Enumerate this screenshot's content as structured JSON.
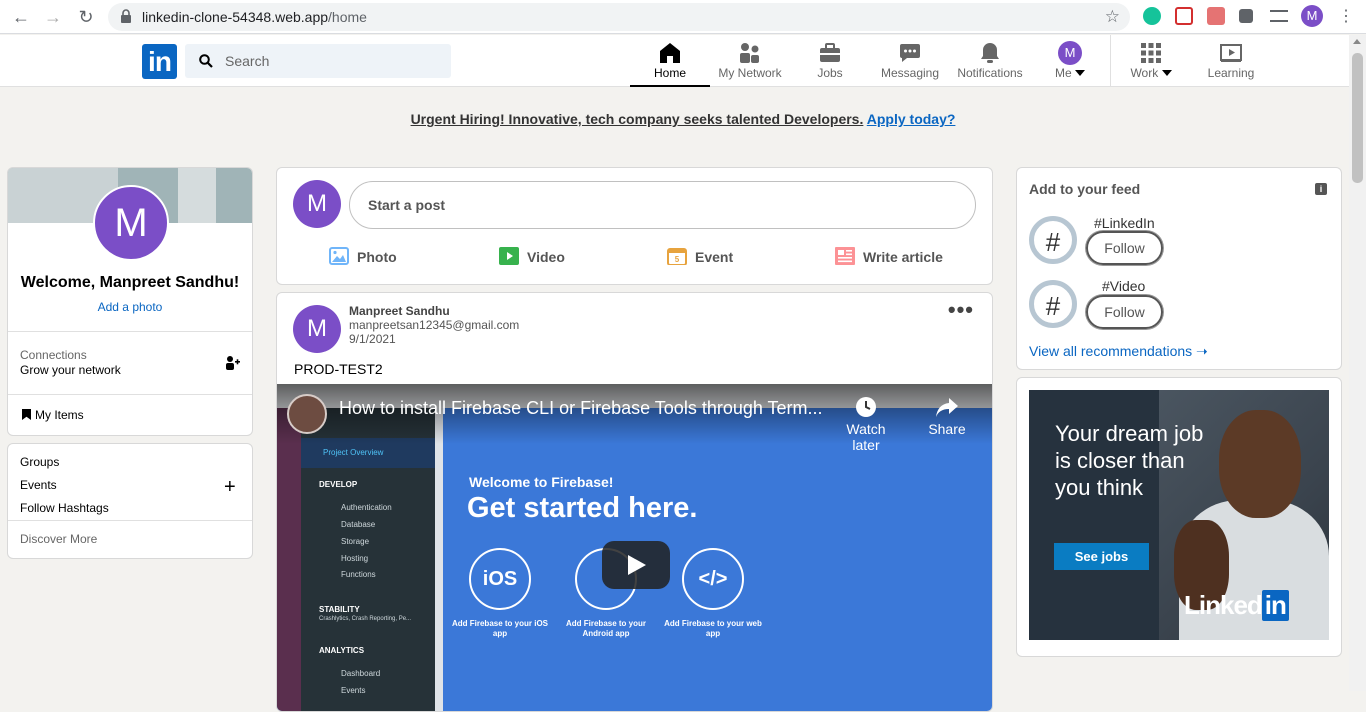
{
  "browser": {
    "url_host": "linkedin-clone-54348.web.app",
    "url_path": "/home",
    "profile_initial": "M"
  },
  "header": {
    "logo_text": "in",
    "search_placeholder": "Search",
    "nav": [
      {
        "label": "Home",
        "icon": "home-icon",
        "active": true
      },
      {
        "label": "My Network",
        "icon": "network-icon"
      },
      {
        "label": "Jobs",
        "icon": "briefcase-icon"
      },
      {
        "label": "Messaging",
        "icon": "messaging-icon"
      },
      {
        "label": "Notifications",
        "icon": "bell-icon"
      },
      {
        "label": "Me",
        "icon": "avatar",
        "initial": "M"
      },
      {
        "label": "Work",
        "icon": "grid-icon"
      },
      {
        "label": "Learning",
        "icon": "learning-icon"
      }
    ]
  },
  "banner": {
    "text": "Urgent Hiring! Innovative, tech company seeks talented Developers.",
    "link": "Apply today?"
  },
  "sidebar": {
    "avatar_initial": "M",
    "welcome": "Welcome, Manpreet Sandhu!",
    "add_photo": "Add a photo",
    "connections_label": "Connections",
    "connections_sub": "Grow your network",
    "my_items": "My Items",
    "groups": "Groups",
    "events": "Events",
    "hashtags": "Follow Hashtags",
    "discover": "Discover More"
  },
  "composer": {
    "avatar_initial": "M",
    "placeholder": "Start a post",
    "actions": [
      "Photo",
      "Video",
      "Event",
      "Write article"
    ]
  },
  "post": {
    "avatar_initial": "M",
    "author": "Manpreet Sandhu",
    "email": "manpreetsan12345@gmail.com",
    "date": "9/1/2021",
    "text": "PROD-TEST2",
    "more": "•••",
    "video": {
      "title": "How to install Firebase CLI or Firebase Tools through Term...",
      "watch_later": "Watch later",
      "share": "Share",
      "welcome": "Welcome to Firebase!",
      "headline": "Get started here.",
      "nav_header": "Project Overview",
      "nav_develop": "DEVELOP",
      "nav_items": [
        "Authentication",
        "Database",
        "Storage",
        "Hosting",
        "Functions"
      ],
      "nav_stability": "STABILITY",
      "nav_stability_sub": "Crashlytics, Crash Reporting, Pe...",
      "nav_analytics": "ANALYTICS",
      "nav_analytics_items": [
        "Dashboard",
        "Events"
      ],
      "platforms": [
        {
          "icon": "iOS",
          "caption": "Add Firebase to your iOS app"
        },
        {
          "icon": "",
          "caption": "Add Firebase to your Android app"
        },
        {
          "icon": "</>",
          "caption": "Add Firebase to your web app"
        }
      ]
    }
  },
  "feed": {
    "title": "Add to your feed",
    "info": "i",
    "hash": "#",
    "items": [
      {
        "tag": "#LinkedIn",
        "button": "Follow"
      },
      {
        "tag": "#Video",
        "button": "Follow"
      }
    ],
    "view_all": "View all recommendations"
  },
  "ad": {
    "headline": "Your dream job is closer than you think",
    "cta": "See jobs",
    "brand_linked": "Linked",
    "brand_in": "in"
  }
}
